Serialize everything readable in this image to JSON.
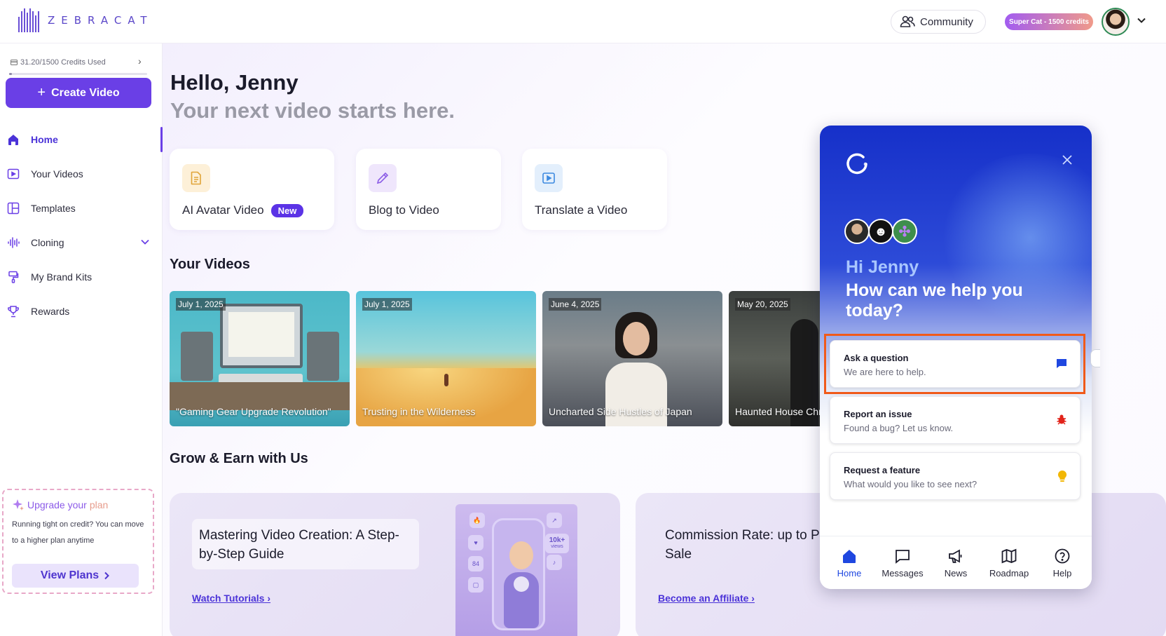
{
  "app": {
    "logo_text": "ZEBRACAT"
  },
  "topbar": {
    "community_label": "Community",
    "plan_badge": "Super Cat - 1500 credits"
  },
  "sidebar": {
    "credits_used": "31.20/1500 Credits Used",
    "credits_fraction": 0.0208,
    "create_label": "Create Video",
    "items": [
      {
        "label": "Home",
        "icon": "home-icon",
        "active": true
      },
      {
        "label": "Your Videos",
        "icon": "video-play-icon",
        "active": false
      },
      {
        "label": "Templates",
        "icon": "templates-icon",
        "active": false
      },
      {
        "label": "Cloning",
        "icon": "waveform-icon",
        "active": false
      },
      {
        "label": "My Brand Kits",
        "icon": "paint-roller-icon",
        "active": false
      },
      {
        "label": "Rewards",
        "icon": "trophy-icon",
        "active": false
      }
    ],
    "upgrade": {
      "title_a": "Upgrade your",
      "title_b": "plan",
      "description": "Running tight on credit? You can move to a higher plan anytime",
      "button": "View Plans"
    }
  },
  "main": {
    "greeting": "Hello, Jenny",
    "subgreeting": "Your next video starts here.",
    "quick_actions": [
      {
        "label": "AI Avatar Video",
        "badge": "New",
        "icon": "document-icon"
      },
      {
        "label": "Blog to Video",
        "icon": "pencil-icon"
      },
      {
        "label": "Translate a Video",
        "icon": "play-icon"
      }
    ],
    "your_videos_title": "Your Videos",
    "videos": [
      {
        "date": "July 1, 2025",
        "title": "\"Gaming Gear Upgrade Revolution\""
      },
      {
        "date": "July 1, 2025",
        "title": "Trusting in the Wilderness"
      },
      {
        "date": "June 4, 2025",
        "title": "Uncharted Side Hustles of Japan"
      },
      {
        "date": "May 20, 2025",
        "title": "Haunted House Chr"
      }
    ],
    "grow_title": "Grow & Earn with Us",
    "promos": [
      {
        "title": "Mastering Video Creation: A Step-by-Step Guide",
        "link": "Watch Tutorials"
      },
      {
        "title": "Commission Rate: up to Per Sale",
        "link": "Become an Affiliate"
      }
    ],
    "promo_art": {
      "stat_a": "10k+",
      "stat_b": "views",
      "stat_c": "84"
    }
  },
  "widget": {
    "greeting": "Hi Jenny",
    "question": "How can we help you today?",
    "options": [
      {
        "title": "Ask a question",
        "subtitle": "We are here to help.",
        "icon": "chat-bubble-icon"
      },
      {
        "title": "Report an issue",
        "subtitle": "Found a bug? Let us know.",
        "icon": "bug-icon"
      },
      {
        "title": "Request a feature",
        "subtitle": "What would you like to see next?",
        "icon": "lightbulb-icon"
      }
    ],
    "tabs": [
      {
        "label": "Home",
        "icon": "home-icon",
        "active": true
      },
      {
        "label": "Messages",
        "icon": "message-icon",
        "active": false
      },
      {
        "label": "News",
        "icon": "megaphone-icon",
        "active": false
      },
      {
        "label": "Roadmap",
        "icon": "map-icon",
        "active": false
      },
      {
        "label": "Help",
        "icon": "help-icon",
        "active": false
      }
    ]
  },
  "colors": {
    "accent": "#6a3fe6",
    "widget_blue": "#1630c9",
    "highlight": "#f05a1a"
  }
}
